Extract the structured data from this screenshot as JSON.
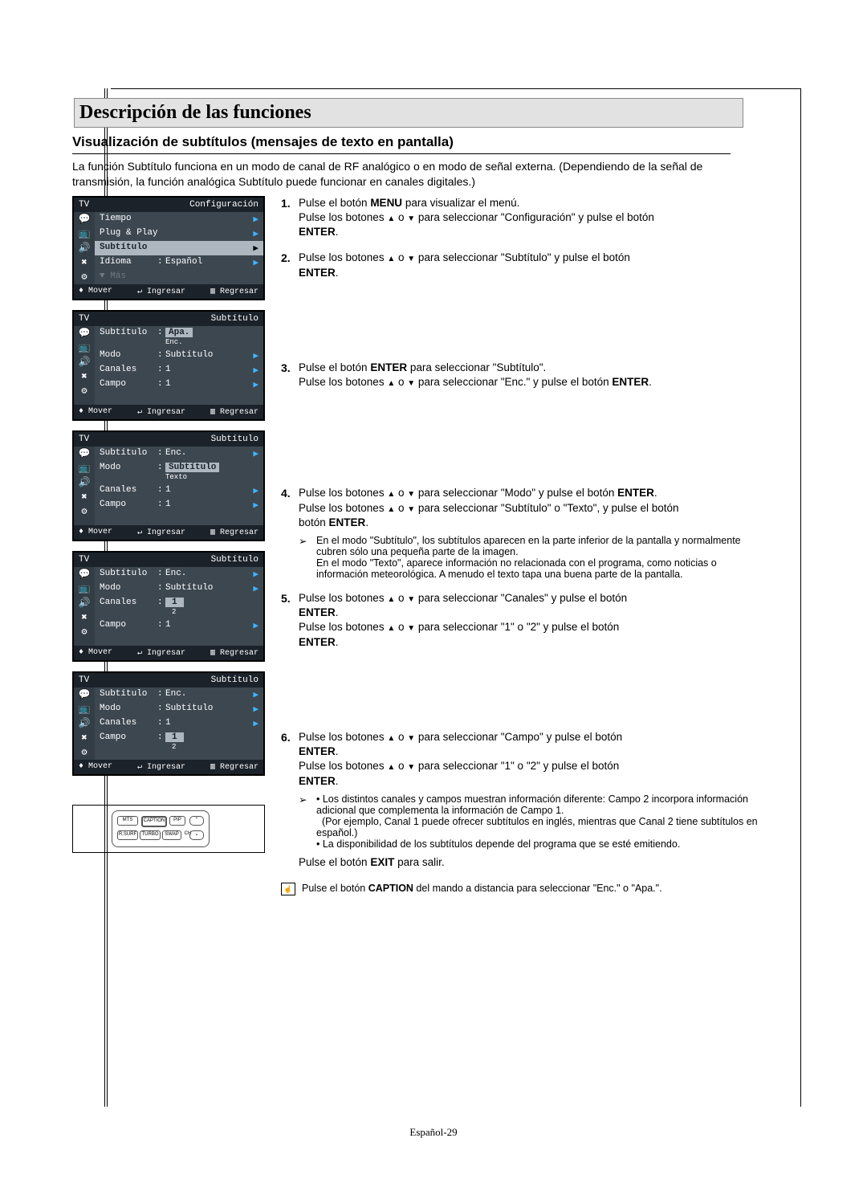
{
  "page": {
    "section_title": "Descripción de las funciones",
    "sub_title": "Visualización de subtítulos (mensajes de texto en pantalla)",
    "intro": "La función Subtítulo funciona en un modo de canal de RF analógico o en modo de señal externa. (Dependiendo de la señal de transmisión, la función analógica Subtítulo puede funcionar en canales digitales.)",
    "page_number": "Español-29"
  },
  "osd": {
    "tv": "TV",
    "mover": "Mover",
    "ingresar": "Ingresar",
    "regresar": "Regresar",
    "more": "▼ Más",
    "menu1": {
      "title": "Configuración",
      "r1": "Tiempo",
      "r2": "Plug & Play",
      "r3": "Subtítulo",
      "r4_l": "Idioma",
      "r4_v": "Español"
    },
    "menu2": {
      "title": "Subtítulo",
      "r1_l": "Subtítulo",
      "r1_v": "Apa.",
      "r1_v2": "Enc.",
      "r2_l": "Modo",
      "r2_v": "Subtítulo",
      "r3_l": "Canales",
      "r3_v": "1",
      "r4_l": "Campo",
      "r4_v": "1"
    },
    "menu3": {
      "title": "Subtítulo",
      "r1_l": "Subtítulo",
      "r1_v": "Enc.",
      "r2_l": "Modo",
      "r2_v": "Subtítulo",
      "r2_v2": "Texto",
      "r3_l": "Canales",
      "r3_v": "1",
      "r4_l": "Campo",
      "r4_v": "1"
    },
    "menu4": {
      "title": "Subtítulo",
      "r1_l": "Subtítulo",
      "r1_v": "Enc.",
      "r2_l": "Modo",
      "r2_v": "Subtítulo",
      "r3_l": "Canales",
      "r3_v": "1",
      "r3_v2": "2",
      "r4_l": "Campo",
      "r4_v": "1"
    },
    "menu5": {
      "title": "Subtítulo",
      "r1_l": "Subtítulo",
      "r1_v": "Enc.",
      "r2_l": "Modo",
      "r2_v": "Subtítulo",
      "r3_l": "Canales",
      "r3_v": "1",
      "r4_l": "Campo",
      "r4_v": "1",
      "r4_v2": "2"
    }
  },
  "steps": {
    "s1_a": "Pulse el botón ",
    "s1_b": "MENU",
    "s1_c": " para visualizar el menú.",
    "s1_d": "Pulse los botones ",
    "s1_e": " o ",
    "s1_f": " para seleccionar \"Configuración\" y pulse el botón ",
    "s1_g": "ENTER",
    "s1_h": ".",
    "s2_a": "Pulse los botones ",
    "s2_b": " o ",
    "s2_c": " para seleccionar \"Subtítulo\" y pulse el botón ",
    "s2_d": "ENTER",
    "s2_e": ".",
    "s3_a": "Pulse el botón ",
    "s3_b": "ENTER",
    "s3_c": " para seleccionar \"Subtítulo\".",
    "s3_d": "Pulse los botones ",
    "s3_e": " o ",
    "s3_f": " para seleccionar \"Enc.\" y pulse el botón ",
    "s3_g": "ENTER",
    "s3_h": ".",
    "s4_a": "Pulse los botones ",
    "s4_b": " o ",
    "s4_c": " para seleccionar \"Modo\" y pulse el botón ",
    "s4_d": "ENTER",
    "s4_e": ".",
    "s4_f": "Pulse los botones ",
    "s4_g": " o ",
    "s4_h": " para seleccionar \"Subtítulo\" o \"Texto\", y pulse el botón ",
    "s4_i": "ENTER",
    "s4_j": ".",
    "s4_note1": "En el modo \"Subtítulo\", los subtítulos aparecen en la parte inferior de la pantalla y normalmente cubren sólo una pequeña parte de la imagen.",
    "s4_note2": "En el modo \"Texto\", aparece información no relacionada con el programa, como noticias o información meteorológica. A menudo el texto tapa una buena parte de la pantalla.",
    "s5_a": "Pulse los botones ",
    "s5_b": " o ",
    "s5_c": " para seleccionar \"Canales\" y pulse el botón ",
    "s5_d": "ENTER",
    "s5_e": ".",
    "s5_f": "Pulse los botones ",
    "s5_g": " o ",
    "s5_h": " para seleccionar \"1\" o \"2\" y pulse el botón ",
    "s5_i": "ENTER",
    "s5_j": ".",
    "s6_a": "Pulse los botones ",
    "s6_b": " o ",
    "s6_c": " para seleccionar \"Campo\" y pulse el botón ",
    "s6_d": "ENTER",
    "s6_e": ".",
    "s6_f": "Pulse los botones ",
    "s6_g": " o ",
    "s6_h": " para seleccionar \"1\" o \"2\" y pulse el botón ",
    "s6_i": "ENTER",
    "s6_j": ".",
    "s6_note1": "Los distintos canales y campos muestran información diferente: Campo 2 incorpora información adicional que complementa la información de Campo 1.",
    "s6_note1b": "(Por ejemplo, Canal 1 puede ofrecer subtítulos en inglés, mientras que Canal 2 tiene subtítulos en español.)",
    "s6_note2": "La disponibilidad de los subtítulos depende del programa que se esté emitiendo.",
    "exit_a": "Pulse el botón ",
    "exit_b": "EXIT",
    "exit_c": " para salir.",
    "tip_a": "Pulse el botón ",
    "tip_b": "CAPTION",
    "tip_c": " del mando a distancia para seleccionar \"Enc.\" o \"Apa.\"."
  },
  "remote": {
    "b1": "MTS",
    "b2": "CAPTION",
    "b3": "PIP",
    "b4": "R.SURF",
    "b5": "TURBO",
    "b6": "SWAP",
    "b7": "CH"
  }
}
